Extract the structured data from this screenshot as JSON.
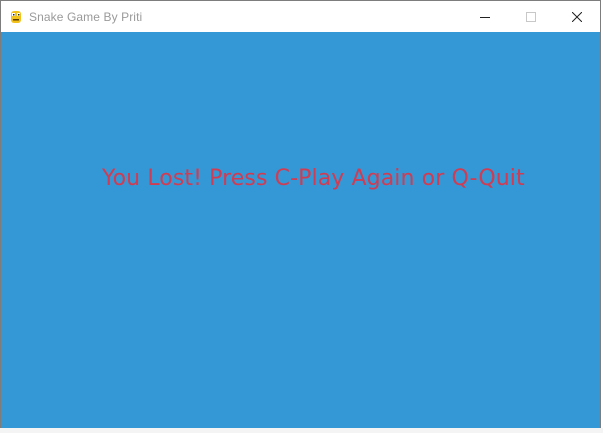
{
  "window": {
    "title": "Snake Game By Priti",
    "icon": "python-snake-icon",
    "controls": {
      "minimize": "minimize-icon",
      "maximize": "maximize-icon",
      "close": "close-icon"
    }
  },
  "game": {
    "message": "You Lost! Press C-Play Again or Q-Quit",
    "background_color": "#3498d6",
    "message_color": "#d13c52"
  }
}
